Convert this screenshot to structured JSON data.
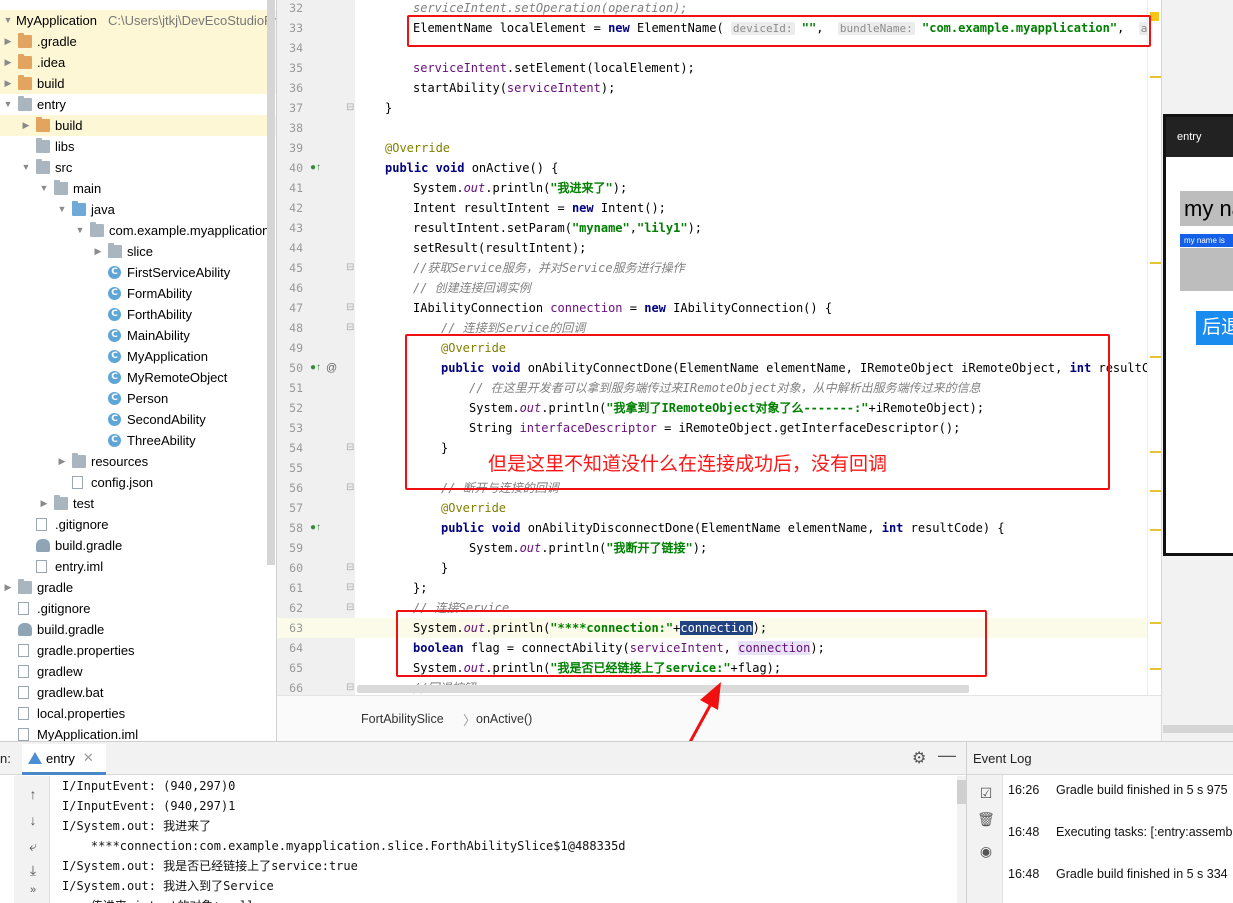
{
  "project_tree": {
    "root_label": "MyApplication",
    "root_path": "C:\\Users\\jtkj\\DevEcoStudioPr",
    "items": [
      {
        "label": ".gradle",
        "depth": 1,
        "icon": "folder",
        "arrow": "right"
      },
      {
        "label": ".idea",
        "depth": 1,
        "icon": "folder",
        "arrow": "right"
      },
      {
        "label": "build",
        "depth": 1,
        "icon": "folder",
        "arrow": "right"
      },
      {
        "label": "entry",
        "depth": 1,
        "icon": "folder-grey",
        "arrow": "down"
      },
      {
        "label": "build",
        "depth": 2,
        "icon": "folder",
        "arrow": "right"
      },
      {
        "label": "libs",
        "depth": 2,
        "icon": "folder-grey",
        "arrow": ""
      },
      {
        "label": "src",
        "depth": 2,
        "icon": "folder-grey",
        "arrow": "down"
      },
      {
        "label": "main",
        "depth": 3,
        "icon": "folder-grey",
        "arrow": "down"
      },
      {
        "label": "java",
        "depth": 4,
        "icon": "folder-blue",
        "arrow": "down"
      },
      {
        "label": "com.example.myapplication",
        "depth": 5,
        "icon": "folder-grey",
        "arrow": "down"
      },
      {
        "label": "slice",
        "depth": 6,
        "icon": "folder-grey",
        "arrow": "right"
      },
      {
        "label": "FirstServiceAbility",
        "depth": 6,
        "icon": "class",
        "arrow": ""
      },
      {
        "label": "FormAbility",
        "depth": 6,
        "icon": "class",
        "arrow": ""
      },
      {
        "label": "ForthAbility",
        "depth": 6,
        "icon": "class",
        "arrow": ""
      },
      {
        "label": "MainAbility",
        "depth": 6,
        "icon": "class",
        "arrow": ""
      },
      {
        "label": "MyApplication",
        "depth": 6,
        "icon": "class",
        "arrow": ""
      },
      {
        "label": "MyRemoteObject",
        "depth": 6,
        "icon": "class",
        "arrow": ""
      },
      {
        "label": "Person",
        "depth": 6,
        "icon": "class",
        "arrow": ""
      },
      {
        "label": "SecondAbility",
        "depth": 6,
        "icon": "class",
        "arrow": ""
      },
      {
        "label": "ThreeAbility",
        "depth": 6,
        "icon": "class",
        "arrow": ""
      },
      {
        "label": "resources",
        "depth": 4,
        "icon": "folder-grey",
        "arrow": "right"
      },
      {
        "label": "config.json",
        "depth": 4,
        "icon": "file",
        "arrow": ""
      },
      {
        "label": "test",
        "depth": 3,
        "icon": "folder-grey",
        "arrow": "right"
      },
      {
        "label": ".gitignore",
        "depth": 2,
        "icon": "file",
        "arrow": ""
      },
      {
        "label": "build.gradle",
        "depth": 2,
        "icon": "gradle",
        "arrow": ""
      },
      {
        "label": "entry.iml",
        "depth": 2,
        "icon": "file",
        "arrow": ""
      },
      {
        "label": "gradle",
        "depth": 1,
        "icon": "folder-grey",
        "arrow": "right"
      },
      {
        "label": ".gitignore",
        "depth": 1,
        "icon": "file",
        "arrow": ""
      },
      {
        "label": "build.gradle",
        "depth": 1,
        "icon": "gradle",
        "arrow": ""
      },
      {
        "label": "gradle.properties",
        "depth": 1,
        "icon": "file",
        "arrow": ""
      },
      {
        "label": "gradlew",
        "depth": 1,
        "icon": "file",
        "arrow": ""
      },
      {
        "label": "gradlew.bat",
        "depth": 1,
        "icon": "file",
        "arrow": ""
      },
      {
        "label": "local.properties",
        "depth": 1,
        "icon": "file",
        "arrow": ""
      },
      {
        "label": "MyApplication.iml",
        "depth": 1,
        "icon": "file",
        "arrow": ""
      }
    ]
  },
  "editor": {
    "lines": [
      {
        "n": "32",
        "html": "<span class=\"cm\">serviceIntent.setOperation(operation);</span>",
        "indent": 2
      },
      {
        "n": "33",
        "html": "ElementName localElement = <span class=\"kw\">new</span> ElementName( <span class=\"hint\">deviceId:</span> <span class=\"st\">\"\"</span>,  <span class=\"hint\">bundleName:</span> <span class=\"st\">\"com.example.myapplication\"</span>,  <span class=\"hint\">abilityNa</span>",
        "indent": 2
      },
      {
        "n": "34",
        "html": "",
        "indent": 2
      },
      {
        "n": "35",
        "html": "<span class=\"fi\">serviceIntent</span>.setElement(localElement);",
        "indent": 2
      },
      {
        "n": "36",
        "html": "startAbility(<span class=\"fi\">serviceIntent</span>);",
        "indent": 2
      },
      {
        "n": "37",
        "html": "}",
        "indent": 1
      },
      {
        "n": "38",
        "html": "",
        "indent": 1
      },
      {
        "n": "39",
        "html": "<span class=\"an\">@Override</span>",
        "indent": 1
      },
      {
        "n": "40",
        "html": "<span class=\"kw\">public void</span> onActive() {",
        "indent": 1
      },
      {
        "n": "41",
        "html": "System.<span class=\"fis\">out</span>.println(<span class=\"st\">\"我进来了\"</span>);",
        "indent": 2
      },
      {
        "n": "42",
        "html": "Intent resultIntent = <span class=\"kw\">new</span> Intent();",
        "indent": 2
      },
      {
        "n": "43",
        "html": "resultIntent.setParam(<span class=\"st\">\"myname\"</span>,<span class=\"st\">\"lily1\"</span>);",
        "indent": 2
      },
      {
        "n": "44",
        "html": "setResult(resultIntent);",
        "indent": 2
      },
      {
        "n": "45",
        "html": "<span class=\"cm\">//获取Service服务，并对Service服务进行操作</span>",
        "indent": 2
      },
      {
        "n": "46",
        "html": "<span class=\"cm\">// 创建连接回调实例</span>",
        "indent": 2
      },
      {
        "n": "47",
        "html": "IAbilityConnection <span class=\"fi\">connection</span> = <span class=\"kw\">new</span> IAbilityConnection() {",
        "indent": 2
      },
      {
        "n": "48",
        "html": "<span class=\"cm\">// 连接到Service的回调</span>",
        "indent": 3
      },
      {
        "n": "49",
        "html": "<span class=\"an\">@Override</span>",
        "indent": 3
      },
      {
        "n": "50",
        "html": "<span class=\"kw\">public void</span> onAbilityConnectDone(ElementName elementName, IRemoteObject iRemoteObject, <span class=\"kw\">int</span> resultCode) {",
        "indent": 3
      },
      {
        "n": "51",
        "html": "<span class=\"cm\">// 在这里开发者可以拿到服务端传过来IRemoteObject对象，从中解析出服务端传过来的信息</span>",
        "indent": 4
      },
      {
        "n": "52",
        "html": "System.<span class=\"fis\">out</span>.println(<span class=\"st\">\"我拿到了IRemoteObject对象了么-------:\"</span>+iRemoteObject);",
        "indent": 4
      },
      {
        "n": "53",
        "html": "String <span class=\"fi\">interfaceDescriptor</span> = iRemoteObject.getInterfaceDescriptor();",
        "indent": 4
      },
      {
        "n": "54",
        "html": "}",
        "indent": 3
      },
      {
        "n": "55",
        "html": "",
        "indent": 3
      },
      {
        "n": "56",
        "html": "<span class=\"cm\">// 断开与连接的回调</span>",
        "indent": 3
      },
      {
        "n": "57",
        "html": "<span class=\"an\">@Override</span>",
        "indent": 3
      },
      {
        "n": "58",
        "html": "<span class=\"kw\">public void</span> onAbilityDisconnectDone(ElementName elementName, <span class=\"kw\">int</span> resultCode) {",
        "indent": 3
      },
      {
        "n": "59",
        "html": "System.<span class=\"fis\">out</span>.println(<span class=\"st\">\"我断开了链接\"</span>);",
        "indent": 4
      },
      {
        "n": "60",
        "html": "}",
        "indent": 3
      },
      {
        "n": "61",
        "html": "};",
        "indent": 2
      },
      {
        "n": "62",
        "html": "<span class=\"cm\">// 连接Service</span>",
        "indent": 2
      },
      {
        "n": "63",
        "html": "System.<span class=\"fis\">out</span>.println(<span class=\"st\">\"****connection:\"</span>+<span class=\"sel-word\">connection</span>);",
        "indent": 2
      },
      {
        "n": "64",
        "html": "<span class=\"kw\">boolean</span> flag = connectAbility(<span class=\"fi\">serviceIntent</span>, <span class=\"ref fi\">connection</span>);",
        "indent": 2
      },
      {
        "n": "65",
        "html": "System.<span class=\"fis\">out</span>.println(<span class=\"st\">\"我是否已经链接上了service:\"</span>+flag);",
        "indent": 2
      },
      {
        "n": "66",
        "html": "<span class=\"cm\">//回退按钮</span>",
        "indent": 2
      }
    ]
  },
  "annotation": {
    "note": "但是这里不知道没什么在连接成功后，没有回调",
    "box_color": "#f01010"
  },
  "breadcrumb": {
    "class_name": "FortAbilitySlice",
    "separator": "〉",
    "method": "onActive()"
  },
  "preview": {
    "title": "entry",
    "name_text": "my na",
    "name_label": "my name is",
    "back_button": "后退"
  },
  "run_panel": {
    "label": "n:",
    "tab": "entry",
    "console": [
      "I/InputEvent: (940,297)0",
      "I/InputEvent: (940,297)1",
      "I/System.out: 我进来了",
      "    ****connection:com.example.myapplication.slice.ForthAbilitySlice$1@488335d",
      "I/System.out: 我是否已经链接上了service:true",
      "I/System.out: 我进入到了Service",
      "    传进来 intent的对象：null"
    ]
  },
  "event_log": {
    "title": "Event Log",
    "entries": [
      {
        "time": "16:26",
        "text": "Gradle build finished in 5 s 975"
      },
      {
        "time": "16:48",
        "text": "Executing tasks: [:entry:assemb"
      },
      {
        "time": "16:48",
        "text": "Gradle build finished in 5 s 334"
      }
    ]
  },
  "colors": {
    "keyword": "#000080",
    "string": "#008000",
    "annotation": "#808000",
    "comment": "#808080",
    "highlight_box": "#f01010",
    "preview_button": "#1a8cf0"
  }
}
